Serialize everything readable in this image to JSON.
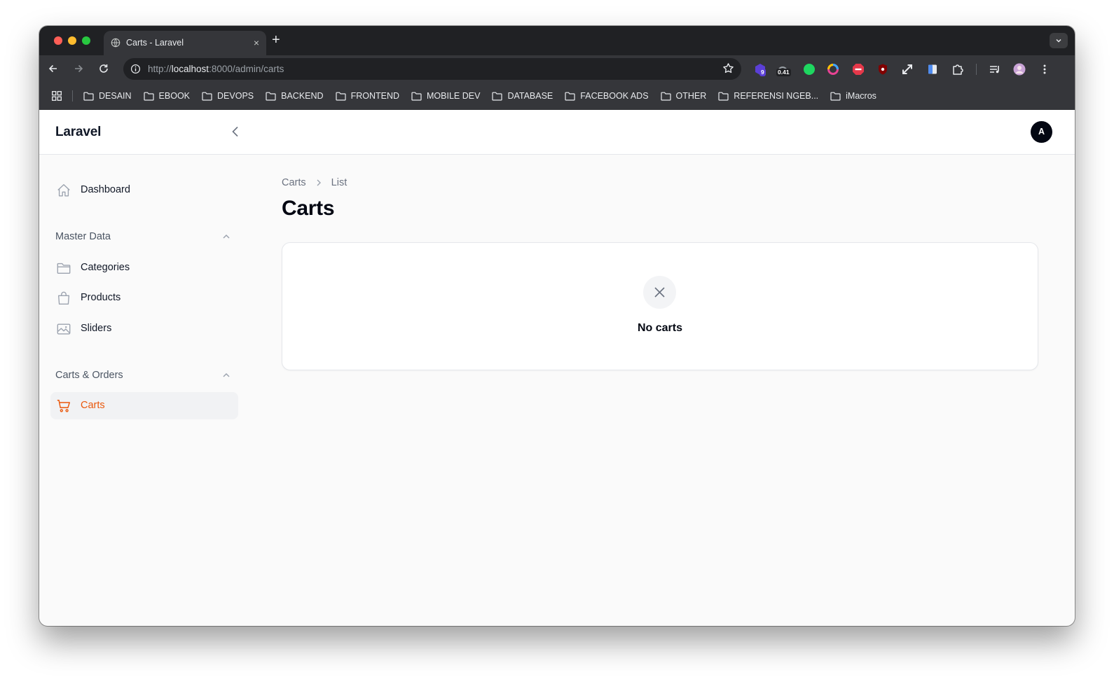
{
  "browser": {
    "tab_title": "Carts - Laravel",
    "tab_close": "×",
    "new_tab": "+",
    "url_prefix": "http://",
    "url_host": "localhost",
    "url_rest": ":8000/admin/carts",
    "extensions": {
      "badge_count": "9",
      "badge_value": "0.41"
    },
    "bookmarks": [
      {
        "label": "DESAIN"
      },
      {
        "label": "EBOOK"
      },
      {
        "label": "DEVOPS"
      },
      {
        "label": "BACKEND"
      },
      {
        "label": "FRONTEND"
      },
      {
        "label": "MOBILE DEV"
      },
      {
        "label": "DATABASE"
      },
      {
        "label": "FACEBOOK ADS"
      },
      {
        "label": "OTHER"
      },
      {
        "label": "REFERENSI NGEB..."
      },
      {
        "label": "iMacros"
      }
    ]
  },
  "app": {
    "brand": "Laravel",
    "avatar_initial": "A",
    "accent_color": "#ea580c"
  },
  "sidebar": {
    "dashboard": {
      "label": "Dashboard",
      "icon": "home-icon"
    },
    "groups": [
      {
        "label": "Master Data",
        "items": [
          {
            "label": "Categories",
            "icon": "folder-icon"
          },
          {
            "label": "Products",
            "icon": "shopping-bag-icon"
          },
          {
            "label": "Sliders",
            "icon": "image-icon"
          }
        ]
      },
      {
        "label": "Carts & Orders",
        "items": [
          {
            "label": "Carts",
            "icon": "shopping-cart-icon",
            "active": true
          }
        ]
      }
    ]
  },
  "main": {
    "breadcrumb": [
      "Carts",
      "List"
    ],
    "title": "Carts",
    "empty_state": {
      "message": "No carts",
      "icon": "x-icon"
    }
  }
}
